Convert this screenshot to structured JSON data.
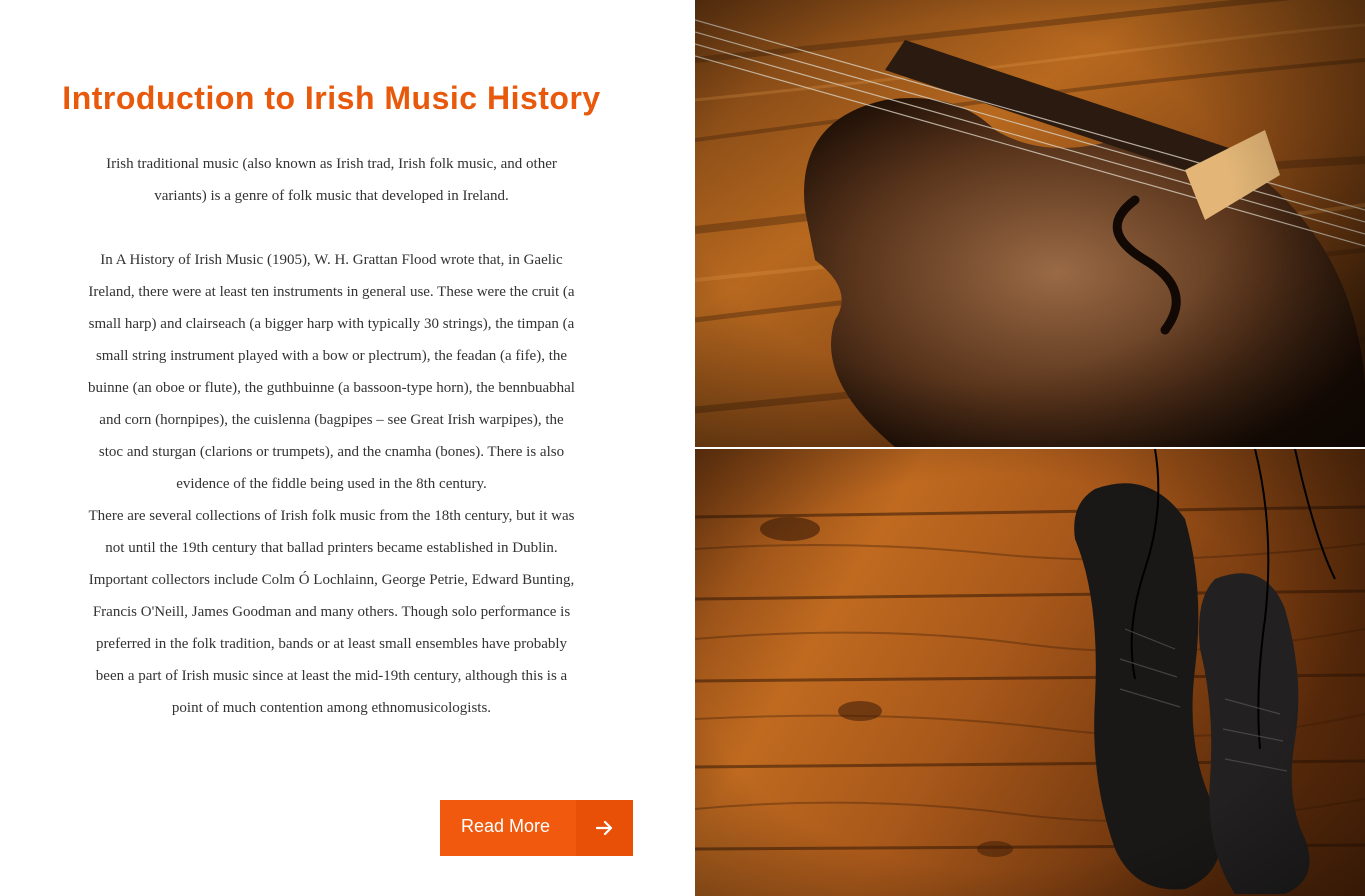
{
  "heading": "Introduction to Irish Music History",
  "paragraphs": [
    "Irish traditional music (also known as Irish trad, Irish folk music, and other variants) is a genre of folk music that developed in Ireland.",
    "In A History of Irish Music (1905), W. H. Grattan Flood wrote that, in Gaelic Ireland, there were at least ten instruments in general use. These were the cruit (a small harp) and clairseach (a bigger harp with typically 30 strings), the timpan (a small string instrument played with a bow or plectrum), the feadan (a fife), the buinne (an oboe or flute), the guthbuinne (a bassoon-type horn), the bennbuabhal and corn (hornpipes), the cuislenna (bagpipes – see Great Irish warpipes), the stoc and sturgan (clarions or trumpets), and the cnamha (bones). There is also evidence of the fiddle being used in the 8th century.",
    "There are several collections of Irish folk music from the 18th century, but it was not until the 19th century that ballad printers became established in Dublin. Important collectors include Colm Ó Lochlainn, George Petrie, Edward Bunting, Francis O'Neill, James Goodman and many others. Though solo performance is preferred in the folk tradition, bands or at least small ensembles have probably been a part of Irish music since at least the mid-19th century, although this is a point of much contention among ethnomusicologists."
  ],
  "read_more": {
    "label": "Read More",
    "icon": "arrow-right-icon"
  },
  "images": {
    "top": "violin-on-wooden-table-photo",
    "bottom": "irish-dance-shoes-on-wood-photo"
  },
  "colors": {
    "accent": "#e8590c",
    "button": "#f15a0e",
    "button_dark": "#e95007"
  }
}
